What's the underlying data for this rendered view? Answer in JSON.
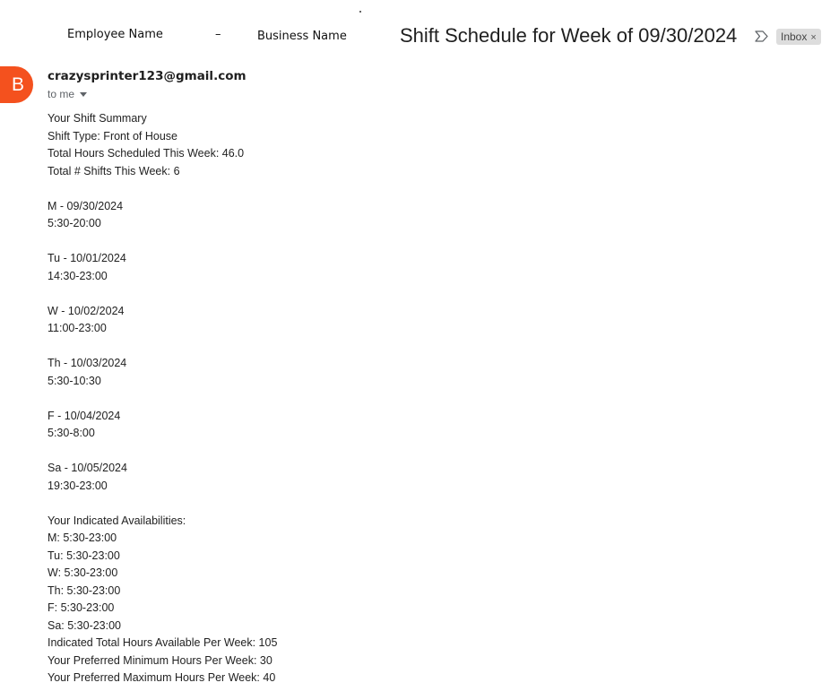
{
  "header": {
    "employee_name": "Employee Name",
    "separator": "–",
    "business_name": "Business Name"
  },
  "email": {
    "subject": "Shift Schedule for Week of 09/30/2024",
    "label": "Inbox",
    "label_close": "×",
    "sender_initial": "B",
    "sender": "crazysprinter123@gmail.com",
    "to": "to me",
    "avatar_color": "#f4511e"
  },
  "body": {
    "summary": {
      "heading": "Your Shift Summary",
      "shift_type": "Shift Type: Front of House",
      "total_hours": "Total Hours Scheduled This Week: 46.0",
      "total_shifts": "Total # Shifts This Week: 6"
    },
    "shifts": [
      {
        "day": "M - 09/30/2024",
        "time": "5:30-20:00"
      },
      {
        "day": "Tu - 10/01/2024",
        "time": "14:30-23:00"
      },
      {
        "day": "W - 10/02/2024",
        "time": "11:00-23:00"
      },
      {
        "day": "Th - 10/03/2024",
        "time": "5:30-10:30"
      },
      {
        "day": "F - 10/04/2024",
        "time": "5:30-8:00"
      },
      {
        "day": "Sa - 10/05/2024",
        "time": "19:30-23:00"
      }
    ],
    "availability": {
      "heading": "Your Indicated Availabilities:",
      "items": [
        "M: 5:30-23:00",
        "Tu: 5:30-23:00",
        "W: 5:30-23:00",
        "Th: 5:30-23:00",
        "F: 5:30-23:00",
        "Sa: 5:30-23:00"
      ],
      "total_available": "Indicated Total Hours Available Per Week: 105",
      "preferred_min": "Your Preferred Minimum Hours Per Week: 30",
      "preferred_max": "Your Preferred Maximum Hours Per Week: 40"
    }
  }
}
